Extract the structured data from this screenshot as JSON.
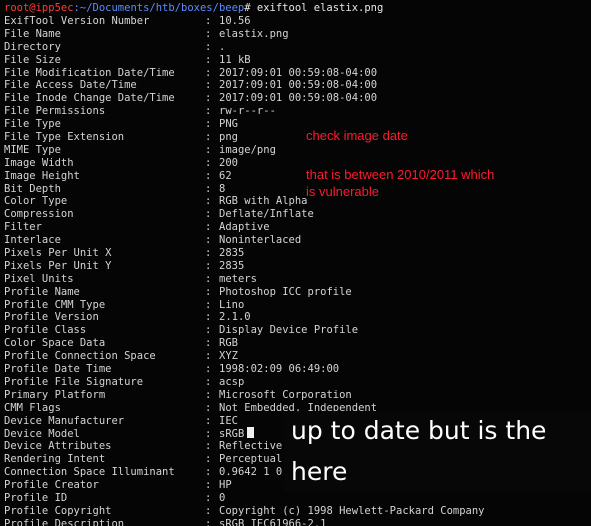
{
  "prompt": {
    "user_host": "root@ipp5ec",
    "path": ":~/Documents/htb/boxes/beep",
    "symbol": "# ",
    "command": "exiftool elastix.png"
  },
  "rows": [
    {
      "key": "ExifTool Version Number",
      "value": "10.56"
    },
    {
      "key": "File Name",
      "value": "elastix.png"
    },
    {
      "key": "Directory",
      "value": "."
    },
    {
      "key": "File Size",
      "value": "11 kB"
    },
    {
      "key": "File Modification Date/Time",
      "value": "2017:09:01 00:59:08-04:00"
    },
    {
      "key": "File Access Date/Time",
      "value": "2017:09:01 00:59:08-04:00"
    },
    {
      "key": "File Inode Change Date/Time",
      "value": "2017:09:01 00:59:08-04:00"
    },
    {
      "key": "File Permissions",
      "value": "rw-r--r--"
    },
    {
      "key": "File Type",
      "value": "PNG"
    },
    {
      "key": "File Type Extension",
      "value": "png"
    },
    {
      "key": "MIME Type",
      "value": "image/png"
    },
    {
      "key": "Image Width",
      "value": "200"
    },
    {
      "key": "Image Height",
      "value": "62"
    },
    {
      "key": "Bit Depth",
      "value": "8"
    },
    {
      "key": "Color Type",
      "value": "RGB with Alpha"
    },
    {
      "key": "Compression",
      "value": "Deflate/Inflate"
    },
    {
      "key": "Filter",
      "value": "Adaptive"
    },
    {
      "key": "Interlace",
      "value": "Noninterlaced"
    },
    {
      "key": "Pixels Per Unit X",
      "value": "2835"
    },
    {
      "key": "Pixels Per Unit Y",
      "value": "2835"
    },
    {
      "key": "Pixel Units",
      "value": "meters"
    },
    {
      "key": "Profile Name",
      "value": "Photoshop ICC profile"
    },
    {
      "key": "Profile CMM Type",
      "value": "Lino"
    },
    {
      "key": "Profile Version",
      "value": "2.1.0"
    },
    {
      "key": "Profile Class",
      "value": "Display Device Profile"
    },
    {
      "key": "Color Space Data",
      "value": "RGB"
    },
    {
      "key": "Profile Connection Space",
      "value": "XYZ"
    },
    {
      "key": "Profile Date Time",
      "value": "1998:02:09 06:49:00"
    },
    {
      "key": "Profile File Signature",
      "value": "acsp"
    },
    {
      "key": "Primary Platform",
      "value": "Microsoft Corporation"
    },
    {
      "key": "CMM Flags",
      "value": "Not Embedded, Independent"
    },
    {
      "key": "Device Manufacturer",
      "value": "IEC"
    },
    {
      "key": "Device Model",
      "value": "sRGB"
    },
    {
      "key": "Device Attributes",
      "value": "Reflective"
    },
    {
      "key": "Rendering Intent",
      "value": "Perceptual"
    },
    {
      "key": "Connection Space Illuminant",
      "value": "0.9642 1 0"
    },
    {
      "key": "Profile Creator",
      "value": "HP"
    },
    {
      "key": "Profile ID",
      "value": "0"
    },
    {
      "key": "Profile Copyright",
      "value": "Copyright (c) 1998 Hewlett-Packard Company"
    },
    {
      "key": "Profile Description",
      "value": "sRGB IEC61966-2.1"
    }
  ],
  "separator": ":",
  "annotations": {
    "line1": "check image date",
    "line2": "that is between 2010/2011 which",
    "line3": "is vulnerable"
  },
  "caption": {
    "line1": "up to date but is the",
    "line2": "here"
  },
  "colors": {
    "background": "#050505",
    "terminal_text": "#d4d4d4",
    "prompt_user": "#ff3b3b",
    "prompt_path": "#5b8cff",
    "annotation": "#ff1a2e",
    "caption_text": "#ffffff"
  }
}
